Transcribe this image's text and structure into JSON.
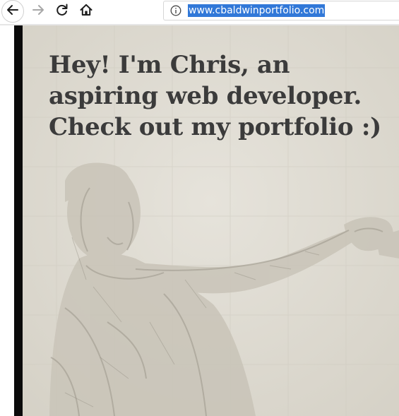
{
  "browser": {
    "url": "www.cbaldwinportfolio.com",
    "icons": {
      "back": "arrow-left-icon",
      "forward": "arrow-right-icon",
      "reload": "reload-icon",
      "home": "home-icon",
      "site_info": "info-icon"
    }
  },
  "hero": {
    "heading_lines": [
      "Hey! I'm Chris, an",
      "aspiring web developer.",
      "Check out my portfolio :)"
    ]
  },
  "colors": {
    "url_highlight": "#3178d8",
    "heading_text": "#3b3b3b",
    "hero_background": "#e0ddd4",
    "left_edge": "#0b0b0b"
  }
}
